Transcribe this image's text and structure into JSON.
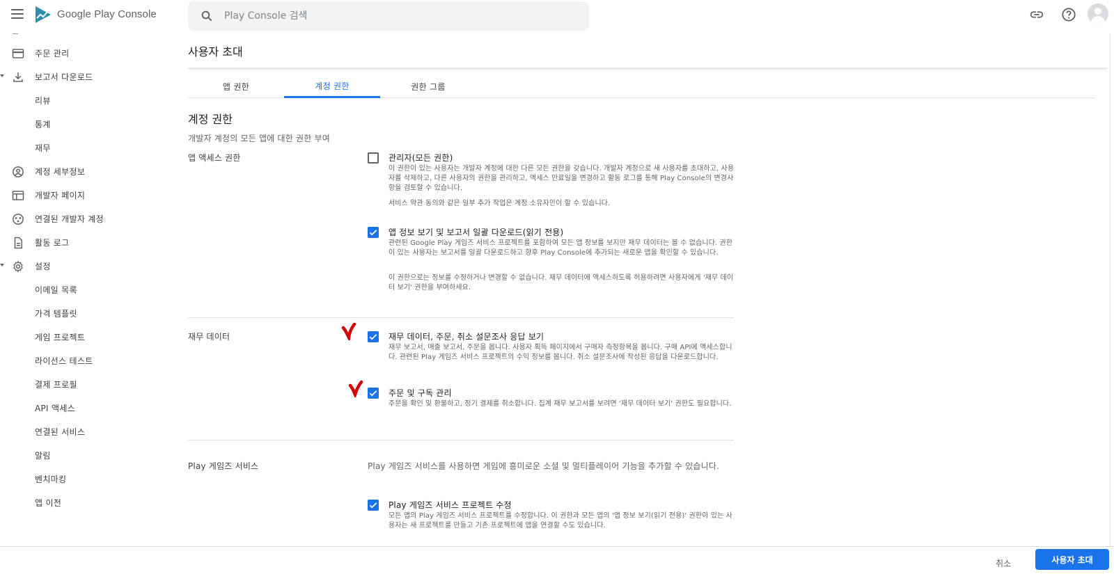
{
  "app": {
    "name": "Google Play Console",
    "search_placeholder": "Play Console 검색"
  },
  "sidebar": {
    "items": [
      {
        "label": "주문 관리",
        "icon": "credit-card-icon"
      },
      {
        "label": "보고서 다운로드",
        "icon": "download-icon"
      },
      {
        "label": "리뷰"
      },
      {
        "label": "통계"
      },
      {
        "label": "재무"
      },
      {
        "label": "계정 세부정보",
        "icon": "account-circle-icon"
      },
      {
        "label": "개발자 페이지",
        "icon": "web-page-icon"
      },
      {
        "label": "연결된 개발자 계정",
        "icon": "linked-accounts-icon"
      },
      {
        "label": "활동 로그",
        "icon": "document-icon"
      },
      {
        "label": "설정",
        "icon": "gear-icon"
      },
      {
        "label": "이메일 목록"
      },
      {
        "label": "가격 템플릿"
      },
      {
        "label": "게임 프로젝트"
      },
      {
        "label": "라이선스 테스트"
      },
      {
        "label": "결제 프로필"
      },
      {
        "label": "API 액세스"
      },
      {
        "label": "연결된 서비스"
      },
      {
        "label": "알림"
      },
      {
        "label": "벤치마킹"
      },
      {
        "label": "앱 이전"
      }
    ]
  },
  "page": {
    "title": "사용자 초대",
    "tabs": [
      {
        "label": "앱 권한",
        "active": false
      },
      {
        "label": "계정 권한",
        "active": true
      },
      {
        "label": "권한 그룹",
        "active": false
      }
    ],
    "section_title": "계정 권한",
    "section_subtitle": "개발자 계정의 모든 앱에 대한 권한 부여"
  },
  "groups": {
    "app_access": {
      "label": "앱 액세스 권한",
      "admin": {
        "checked": false,
        "title": "관리자(모든 권한)",
        "description": "이 권한이 있는 사용자는 개발자 계정에 대한 다른 모든 권한을 갖습니다. 개발자 계정으로 새 사용자를 초대하고, 사용자를 삭제하고, 다른 사용자의 권한을 관리하고, 액세스 만료일을 변경하고 활동 로그를 통해 Play Console의 변경사항을 검토할 수 있습니다.",
        "note": "서비스 약관 동의와 같은 일부 추가 작업은 계정 소유자만이 할 수 있습니다."
      },
      "view_app_info": {
        "checked": true,
        "title": "앱 정보 보기 및 보고서 일괄 다운로드(읽기 전용)",
        "description": "관련된 Google Play 게임즈 서비스 프로젝트를 포함하여 모든 앱 정보를 보지만 재무 데이터는 볼 수 없습니다. 권한이 있는 사용자는 보고서를 일괄 다운로드하고 향후 Play Console에 추가되는 새로운 앱을 확인할 수 있습니다.",
        "note": "이 권한으로는 정보를 수정하거나 변경할 수 없습니다. 재무 데이터에 액세스하도록 허용하려면 사용자에게 '재무 데이터 보기' 권한을 부여하세요."
      }
    },
    "financial": {
      "label": "재무 데이터",
      "view_financial": {
        "checked": true,
        "title": "재무 데이터, 주문, 취소 설문조사 응답 보기",
        "description": "재무 보고서, 매출 보고서, 주문을 봅니다. 사용자 획득 페이지에서 구매자 측정항목을 봅니다. 구매 API에 액세스합니다. 관련된 Play 게임즈 서비스 프로젝트의 수익 정보를 봅니다. 취소 설문조사에 작성된 응답을 다운로드합니다."
      },
      "manage_orders": {
        "checked": true,
        "title": "주문 및 구독 관리",
        "description": "주문을 확인 및 환불하고, 정기 결제를 취소합니다. 집계 재무 보고서를 보려면 '재무 데이터 보기' 권한도 필요합니다."
      }
    },
    "play_games": {
      "label": "Play 게임즈 서비스",
      "description": "Play 게임즈 서비스를 사용하면 게임에 흥미로운 소셜 및 멀티플레이어 기능을 추가할 수 있습니다.",
      "edit_projects": {
        "checked": true,
        "title": "Play 게임즈 서비스 프로젝트 수정",
        "description": "모든 앱의 Play 게임즈 서비스 프로젝트를 수정합니다. 이 권한과 모든 앱의 '앱 정보 보기(읽기 전용)' 권한이 있는 사용자는 새 프로젝트를 만들고 기존 프로젝트에 앱을 연결할 수도 있습니다."
      }
    }
  },
  "footer": {
    "cancel_label": "취소",
    "invite_label": "사용자 초대"
  },
  "colors": {
    "accent": "#1a73e8",
    "annotation": "#d50000"
  }
}
